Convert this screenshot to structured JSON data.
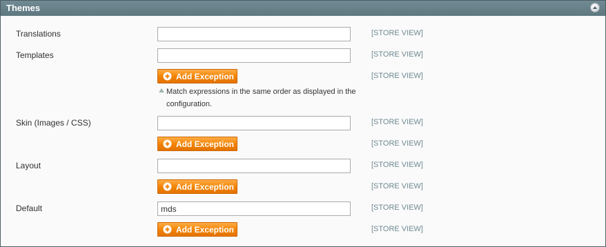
{
  "section": {
    "title": "Themes"
  },
  "rows": [
    {
      "label": "Translations",
      "value": "",
      "scope": "[STORE VIEW]"
    },
    {
      "label": "Templates",
      "value": "",
      "scope": "[STORE VIEW]"
    },
    {
      "label": "Skin (Images / CSS)",
      "value": "",
      "scope": "[STORE VIEW]"
    },
    {
      "label": "Layout",
      "value": "",
      "scope": "[STORE VIEW]"
    },
    {
      "label": "Default",
      "value": "mds",
      "scope": "[STORE VIEW]"
    }
  ],
  "exceptions": [
    {
      "button_label": "Add Exception",
      "scope": "[STORE VIEW]"
    },
    {
      "button_label": "Add Exception",
      "scope": "[STORE VIEW]"
    },
    {
      "button_label": "Add Exception",
      "scope": "[STORE VIEW]"
    },
    {
      "button_label": "Add Exception",
      "scope": "[STORE VIEW]"
    }
  ],
  "note": "Match expressions in the same order as displayed in the configuration.",
  "icons": {
    "collapse": "collapse-up-icon",
    "add": "plus-circle-icon",
    "note": "triangle-up-icon"
  },
  "colors": {
    "header": "#6a838b",
    "button": "#f18200",
    "scope_text": "#6f8992"
  }
}
